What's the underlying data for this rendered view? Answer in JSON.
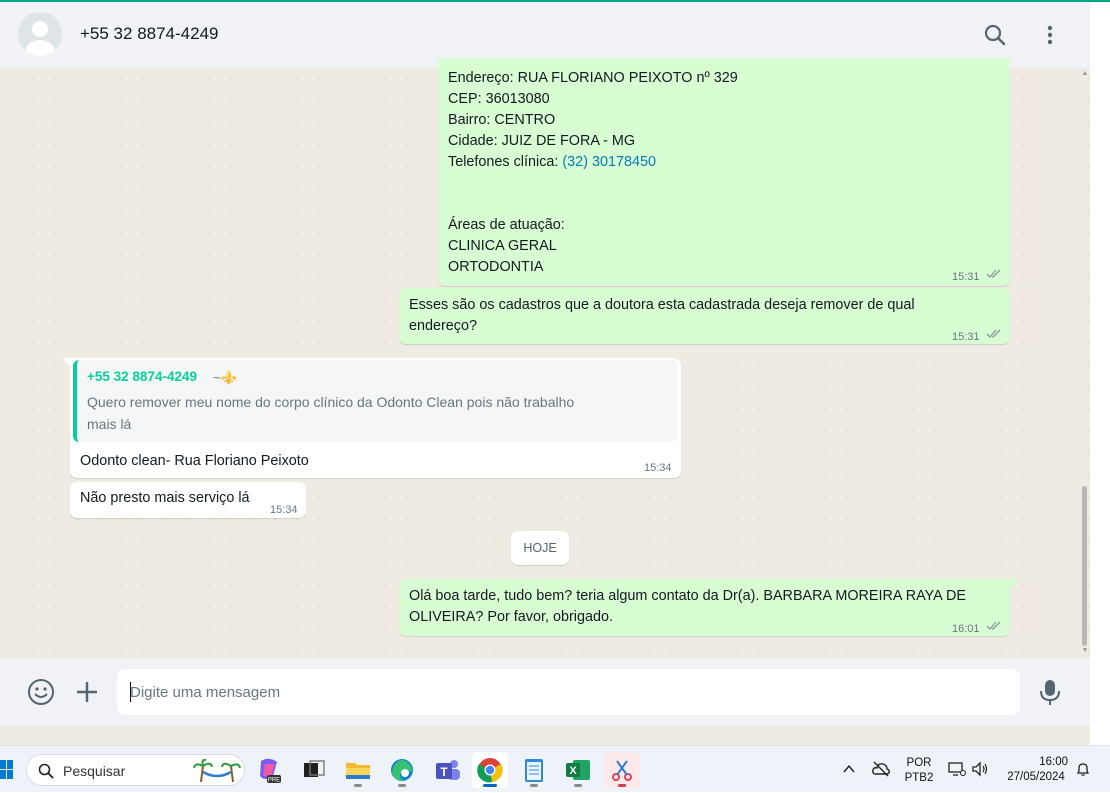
{
  "header": {
    "contact": "+55 32 8874-4249",
    "icons": [
      "avatar",
      "search-icon",
      "menu-dots-icon"
    ]
  },
  "messages": {
    "m1": {
      "lines": [
        "Endereço: RUA FLORIANO PEIXOTO nº 329",
        "CEP: 36013080",
        "Bairro: CENTRO",
        "Cidade: JUIZ DE FORA - MG"
      ],
      "phone_label": "Telefones clínica: ",
      "phone_link": "(32) 30178450",
      "areas_title": "Áreas de atuação:",
      "areas": [
        "CLINICA GERAL",
        "ORTODONTIA"
      ],
      "time": "15:31"
    },
    "m2": {
      "text": "Esses são os cadastros que a doutora esta cadastrada deseja remover de qual endereço?",
      "time": "15:31"
    },
    "m3": {
      "quote_author": "+55 32 8874-4249",
      "quote_sub": "~⚜️",
      "quote_text": "Quero remover meu nome do corpo clínico da Odonto Clean pois não trabalho mais lá",
      "text": "Odonto clean- Rua Floriano Peixoto",
      "time": "15:34"
    },
    "m4": {
      "text": "Não presto mais serviço lá",
      "time": "15:34"
    },
    "day_chip": "HOJE",
    "m5": {
      "text": "Olá boa tarde, tudo bem? teria algum contato da Dr(a). BARBARA MOREIRA RAYA DE OLIVEIRA? Por favor, obrigado.",
      "time": "16:01"
    }
  },
  "composer": {
    "placeholder": "Digite uma mensagem"
  },
  "taskbar": {
    "search_label": "Pesquisar",
    "language": "POR",
    "layout": "PTB2",
    "time": "16:00",
    "date": "27/05/2024"
  },
  "colors": {
    "accent": "#00a884",
    "outgoing_bubble": "#d9fdd3",
    "incoming_bubble": "#ffffff",
    "chat_bg": "#efeae2",
    "link": "#027eb5"
  }
}
